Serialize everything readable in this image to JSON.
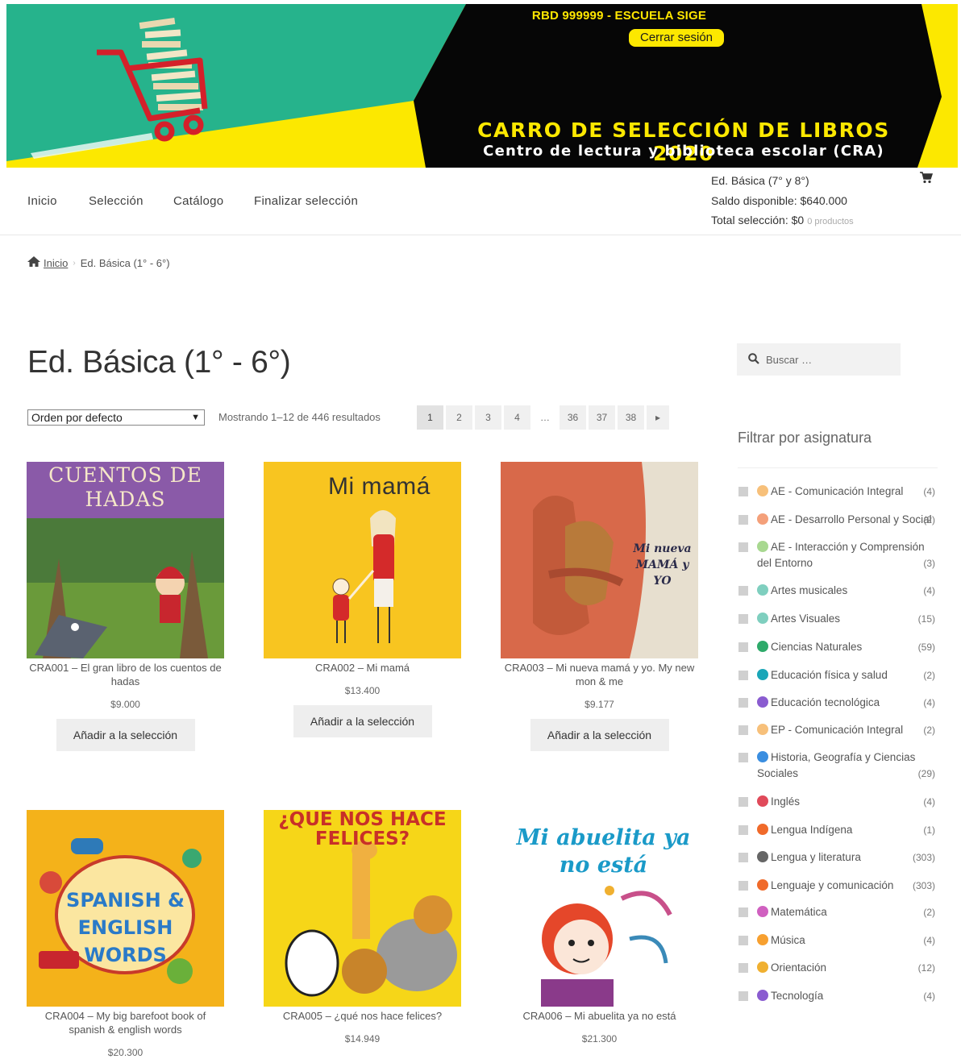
{
  "banner": {
    "rbd": "RBD 999999 - ESCUELA SIGE",
    "logout": "Cerrar sesión",
    "title": "CARRO DE SELECCIÓN DE LIBROS 2020",
    "subtitle": "Centro de lectura y biblioteca escolar (CRA)"
  },
  "nav": {
    "items": [
      "Inicio",
      "Selección",
      "Catálogo",
      "Finalizar selección"
    ]
  },
  "cart": {
    "level": "Ed. Básica (7° y 8°)",
    "balance": "Saldo disponible: $640.000",
    "total": "Total selección: $0",
    "products": "0 productos"
  },
  "breadcrumb": {
    "home": "Inicio",
    "current": "Ed. Básica (1° - 6°)"
  },
  "page_title": "Ed. Básica (1° - 6°)",
  "toolbar": {
    "orderby": "Orden por defecto",
    "result_count": "Mostrando 1–12 de 446 resultados",
    "pages": [
      "1",
      "2",
      "3",
      "4",
      "…",
      "36",
      "37",
      "38"
    ],
    "current_page": "1",
    "next": "▸"
  },
  "products": [
    {
      "name": "CRA001 – El gran libro de los cuentos de hadas",
      "price": "$9.000",
      "button": "Añadir a la selección",
      "cover_text": "CUENTOS DE HADAS"
    },
    {
      "name": "CRA002 – Mi mamá",
      "price": "$13.400",
      "button": "Añadir a la selección",
      "cover_text": "Mi mamá"
    },
    {
      "name": "CRA003 – Mi nueva mamá y yo. My new mon & me",
      "price": "$9.177",
      "button": "Añadir a la selección",
      "cover_text": "Mi nueva MAMÁ y YO"
    },
    {
      "name": "CRA004 – My big barefoot book of spanish & english words",
      "price": "$20.300",
      "button": "Añadir a la selección",
      "cover_text": "SPANISH & ENGLISH WORDS"
    },
    {
      "name": "CRA005 – ¿qué nos hace felices?",
      "price": "$14.949",
      "button": "Añadir a la selección",
      "cover_text": "¿QUE NOS HACE FELICES?"
    },
    {
      "name": "CRA006 – Mi abuelita ya no está",
      "price": "$21.300",
      "button": "Añadir a la selección",
      "cover_text": "Mi abuelita ya no está"
    }
  ],
  "sidebar": {
    "search_placeholder": "Buscar …",
    "filter_title": "Filtrar por asignatura",
    "filters": [
      {
        "label": "AE - Comunicación Integral",
        "count": "(4)",
        "color": "#f7c07a"
      },
      {
        "label": "AE - Desarrollo Personal y Social",
        "count": "(2)",
        "color": "#f4a07a"
      },
      {
        "label": "AE - Interacción y Comprensión del Entorno",
        "count": "(3)",
        "color": "#a8d890"
      },
      {
        "label": "Artes musicales",
        "count": "(4)",
        "color": "#7fcfbf"
      },
      {
        "label": "Artes Visuales",
        "count": "(15)",
        "color": "#7fcfbf"
      },
      {
        "label": "Ciencias Naturales",
        "count": "(59)",
        "color": "#2eaa6a"
      },
      {
        "label": "Educación física y salud",
        "count": "(2)",
        "color": "#1aa6b8"
      },
      {
        "label": "Educación tecnológica",
        "count": "(4)",
        "color": "#8a5cd0"
      },
      {
        "label": "EP - Comunicación Integral",
        "count": "(2)",
        "color": "#f7c07a"
      },
      {
        "label": "Historia, Geografía y Ciencias Sociales",
        "count": "(29)",
        "color": "#3a8ee0"
      },
      {
        "label": "Inglés",
        "count": "(4)",
        "color": "#e04a5a"
      },
      {
        "label": "Lengua Indígena",
        "count": "(1)",
        "color": "#f06a2a"
      },
      {
        "label": "Lengua y literatura",
        "count": "(303)",
        "color": "#666666"
      },
      {
        "label": "Lenguaje y comunicación",
        "count": "(303)",
        "color": "#f06a2a"
      },
      {
        "label": "Matemática",
        "count": "(2)",
        "color": "#d060c0"
      },
      {
        "label": "Música",
        "count": "(4)",
        "color": "#f7a030"
      },
      {
        "label": "Orientación",
        "count": "(12)",
        "color": "#f0b030"
      },
      {
        "label": "Tecnología",
        "count": "(4)",
        "color": "#8a5cd0"
      }
    ]
  }
}
